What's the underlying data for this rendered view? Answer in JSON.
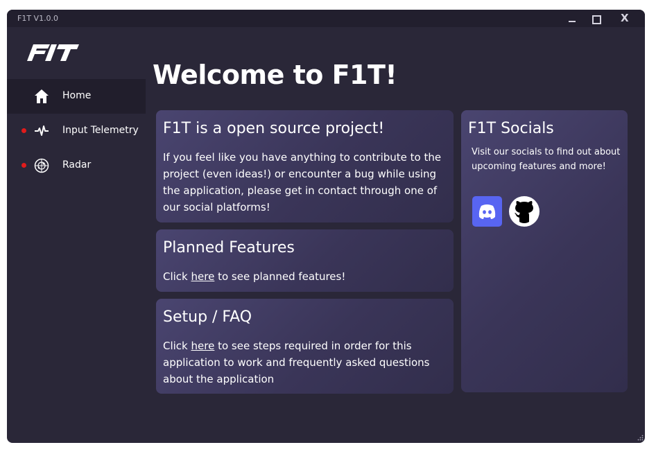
{
  "window": {
    "title": "F1T V1.0.0",
    "controls": {
      "close_label": "X"
    }
  },
  "sidebar": {
    "items": [
      {
        "label": "Home",
        "icon": "home-icon",
        "active": true
      },
      {
        "label": "Input Telemetry",
        "icon": "pulse-icon",
        "status_color": "#e01b1b"
      },
      {
        "label": "Radar",
        "icon": "radar-icon",
        "status_color": "#e01b1b"
      }
    ]
  },
  "main": {
    "heading": "Welcome to F1T!",
    "cards": {
      "open_source": {
        "title": "F1T is a open source project!",
        "body": "If you feel like you have anything to contribute to the project (even ideas!) or encounter a bug while using the application, please get in contact through one of our social platforms!"
      },
      "planned": {
        "title": "Planned Features",
        "prefix": "Click ",
        "link": "here",
        "suffix": " to see planned features!"
      },
      "setup": {
        "title": "Setup / FAQ",
        "prefix": "Click ",
        "link": "here",
        "suffix": " to see steps required in order for this application to work and frequently asked questions about the application"
      },
      "socials": {
        "title": "F1T Socials",
        "body": "Visit our socials to find out about upcoming features and more!",
        "links": [
          {
            "icon": "discord-icon",
            "color": "#5865f2"
          },
          {
            "icon": "github-icon"
          }
        ]
      }
    }
  },
  "colors": {
    "window_bg": "#2a2738",
    "titlebar_bg": "#221f2e",
    "card_accent": "#4a4570",
    "status_red": "#e01b1b"
  }
}
